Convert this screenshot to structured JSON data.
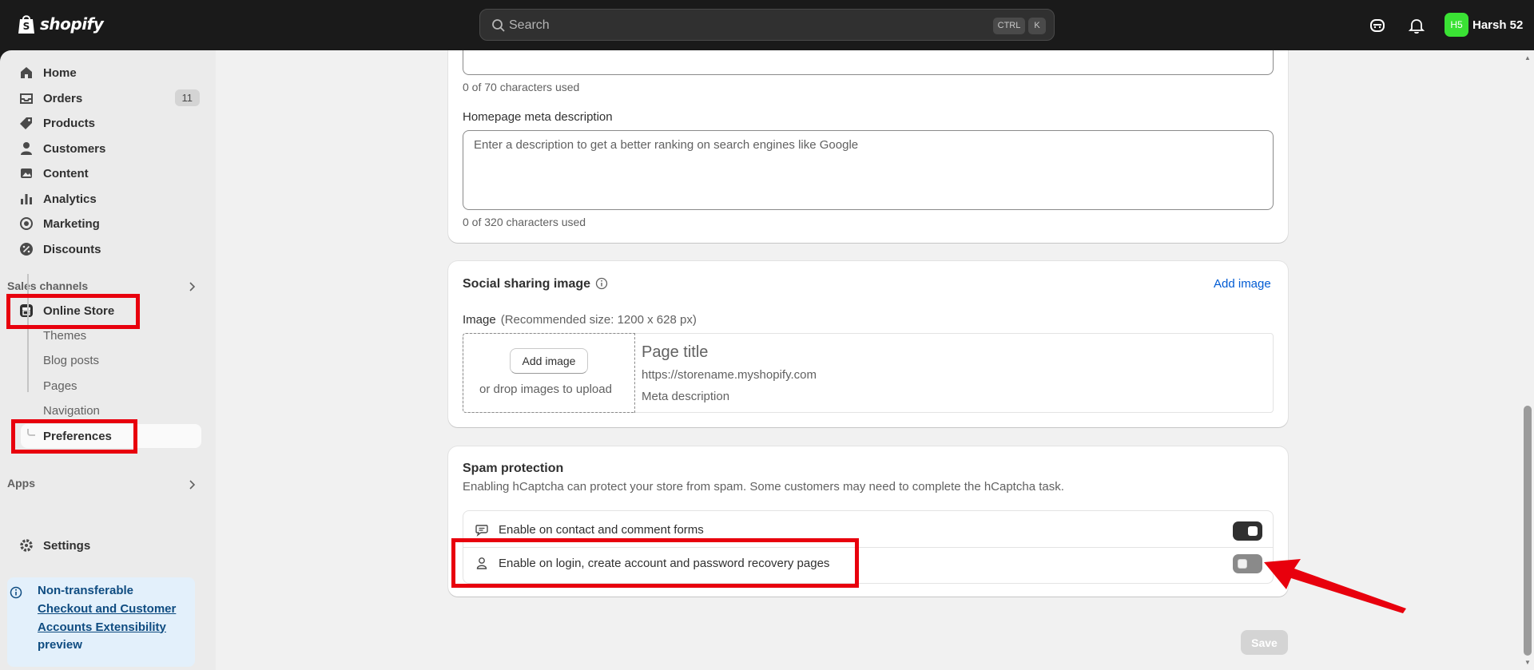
{
  "topbar": {
    "brand": "shopify",
    "search_placeholder": "Search",
    "kbd_ctrl": "CTRL",
    "kbd_k": "K",
    "user_initials": "H5",
    "user_name": "Harsh 52"
  },
  "sidebar": {
    "items": [
      {
        "label": "Home",
        "icon": "home-icon"
      },
      {
        "label": "Orders",
        "icon": "orders-icon",
        "badge": "11"
      },
      {
        "label": "Products",
        "icon": "tag-icon"
      },
      {
        "label": "Customers",
        "icon": "person-icon"
      },
      {
        "label": "Content",
        "icon": "content-icon"
      },
      {
        "label": "Analytics",
        "icon": "bar-chart-icon"
      },
      {
        "label": "Marketing",
        "icon": "target-icon"
      },
      {
        "label": "Discounts",
        "icon": "discount-icon"
      }
    ],
    "sales_channels_label": "Sales channels",
    "online_store": "Online Store",
    "sub_items": [
      "Themes",
      "Blog posts",
      "Pages",
      "Navigation",
      "Preferences"
    ],
    "apps_label": "Apps",
    "settings": "Settings",
    "promo": {
      "title": "Non-transferable",
      "link": "Checkout and Customer Accounts Extensibility",
      "tail": "preview"
    }
  },
  "seo": {
    "title_count": "0 of 70 characters used",
    "meta_label": "Homepage meta description",
    "meta_placeholder": "Enter a description to get a better ranking on search engines like Google",
    "meta_count": "0 of 320 characters used"
  },
  "social": {
    "title": "Social sharing image",
    "add_image_link": "Add image",
    "image_label": "Image",
    "image_hint": "(Recommended size: 1200 x 628 px)",
    "add_image_button": "Add image",
    "drop_hint": "or drop images to upload",
    "preview_title": "Page title",
    "preview_url": "https://storename.myshopify.com",
    "preview_meta": "Meta description"
  },
  "spam": {
    "title": "Spam protection",
    "description": "Enabling hCaptcha can protect your store from spam. Some customers may need to complete the hCaptcha task.",
    "options": [
      {
        "label": "Enable on contact and comment forms",
        "enabled": true,
        "icon": "chat-bubble-icon"
      },
      {
        "label": "Enable on login, create account and password recovery pages",
        "enabled": false,
        "icon": "person-icon"
      }
    ]
  },
  "footer": {
    "save_label": "Save"
  },
  "colors": {
    "topbar": "#1a1a1a",
    "sidebar": "#ebebeb",
    "accent_link": "#005bd3",
    "annotation_red": "#e8000d",
    "avatar": "#3ae234"
  }
}
